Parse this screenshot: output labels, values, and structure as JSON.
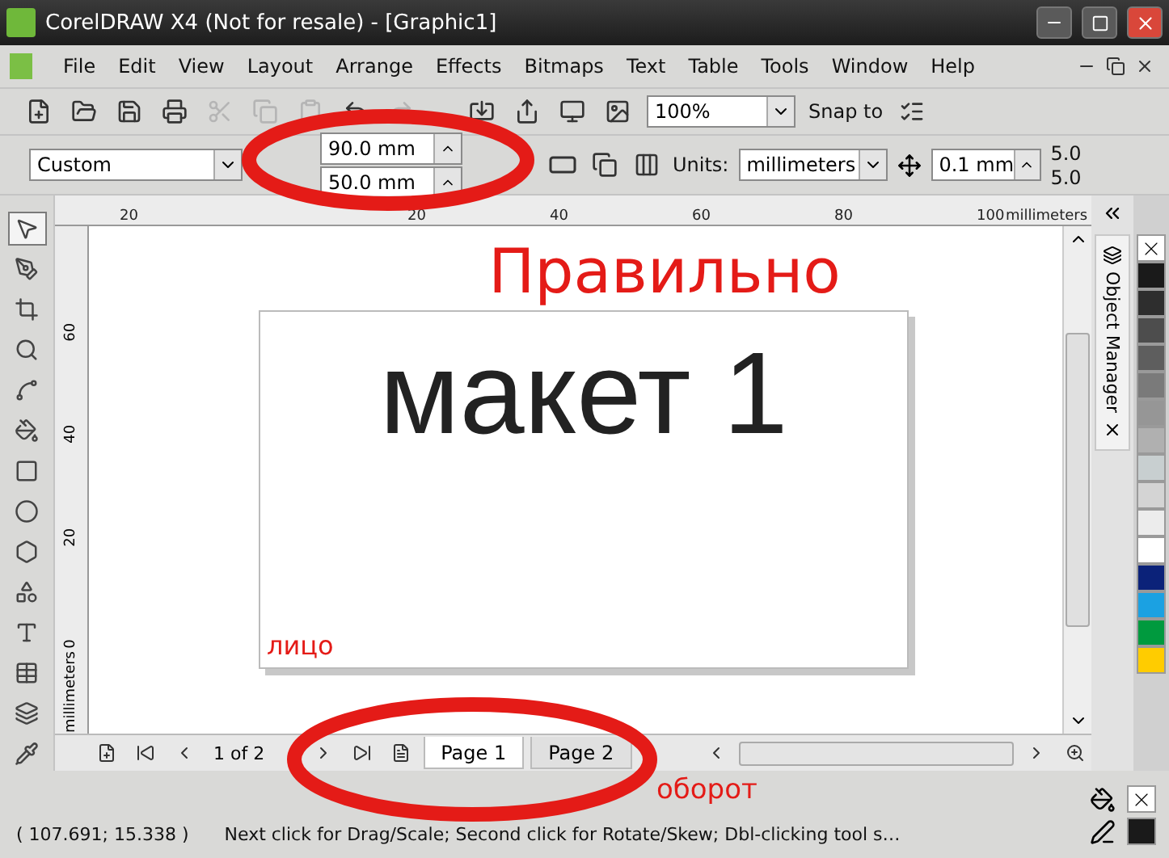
{
  "window": {
    "title": "CorelDRAW X4 (Not for resale) - [Graphic1]"
  },
  "menu": [
    "File",
    "Edit",
    "View",
    "Layout",
    "Arrange",
    "Effects",
    "Bitmaps",
    "Text",
    "Table",
    "Tools",
    "Window",
    "Help"
  ],
  "toolbar": {
    "zoom": "100%",
    "snap": "Snap to"
  },
  "property_bar": {
    "preset": "Custom",
    "width": "90.0 mm",
    "height": "50.0 mm",
    "units_label": "Units:",
    "units": "millimeters",
    "nudge": "0.1 mm",
    "x_value": "5.0",
    "y_value": "5.0"
  },
  "toolbox": [
    {
      "kind": "pick",
      "selected": true
    },
    {
      "kind": "shape",
      "selected": false
    },
    {
      "kind": "crop",
      "selected": false
    },
    {
      "kind": "zoom",
      "selected": false
    },
    {
      "kind": "curve",
      "selected": false
    },
    {
      "kind": "fill",
      "selected": false
    },
    {
      "kind": "rect",
      "selected": false
    },
    {
      "kind": "ellipse",
      "selected": false
    },
    {
      "kind": "polygon",
      "selected": false
    },
    {
      "kind": "shapes",
      "selected": false
    },
    {
      "kind": "text",
      "selected": false
    },
    {
      "kind": "table",
      "selected": false
    },
    {
      "kind": "effects",
      "selected": false
    },
    {
      "kind": "eyedropper",
      "selected": false
    }
  ],
  "rulers": {
    "horizontal": [
      "20",
      "20",
      "40",
      "60",
      "80",
      "100"
    ],
    "horizontal_unit": "millimeters",
    "vertical": [
      "60",
      "40",
      "20",
      "0"
    ],
    "vertical_unit": "millimeters"
  },
  "page": {
    "text": "макет 1"
  },
  "annotations": {
    "top": "Правильно",
    "front": "лицо",
    "back": "оборот"
  },
  "docker": {
    "title": "Object Manager"
  },
  "palette": [
    {
      "kind": "none"
    },
    {
      "color": "#1a1a1a"
    },
    {
      "color": "#2e2e2e"
    },
    {
      "color": "#4d4d4d"
    },
    {
      "color": "#5e5e5e"
    },
    {
      "color": "#7a7a7a"
    },
    {
      "color": "#969696"
    },
    {
      "color": "#b0b0b0"
    },
    {
      "color": "#c8cfd0"
    },
    {
      "color": "#d4d4d4"
    },
    {
      "color": "#ececec"
    },
    {
      "color": "#ffffff"
    },
    {
      "color": "#0b2279"
    },
    {
      "color": "#1ba1e2"
    },
    {
      "color": "#009a3e"
    },
    {
      "color": "#ffcc00"
    }
  ],
  "page_nav": {
    "counter": "1 of 2",
    "tabs": [
      {
        "label": "Page 1",
        "selected": true
      },
      {
        "label": "Page 2",
        "selected": false
      }
    ]
  },
  "status": {
    "coordinates": "( 107.691; 15.338 )",
    "message": "Next click for Drag/Scale; Second click for Rotate/Skew; Dbl-clicking tool s…"
  }
}
